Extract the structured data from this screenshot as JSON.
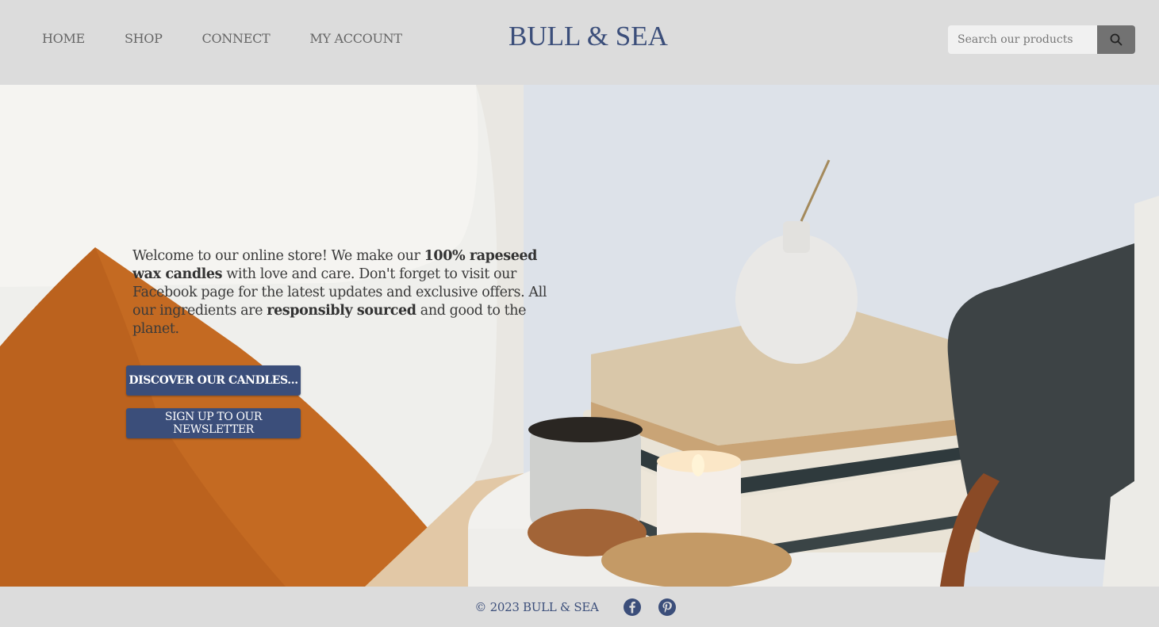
{
  "nav": {
    "items": [
      {
        "label": "HOME"
      },
      {
        "label": "SHOP"
      },
      {
        "label": "CONNECT"
      },
      {
        "label": "MY ACCOUNT"
      }
    ]
  },
  "brand": {
    "logo": "BULL & SEA",
    "color": "#3b4e7a"
  },
  "search": {
    "placeholder": "Search our products",
    "icon": "search-icon"
  },
  "hero": {
    "intro_1": "Welcome to our online store! We make our ",
    "intro_bold_1": "100% rapeseed wax candles",
    "intro_2": " with love and care. Don't forget to visit our Facebook page for the latest updates and exclusive offers. All our ingredients are ",
    "intro_bold_2": "responsibly sourced",
    "intro_3": " and good to the planet.",
    "discover_button": "DISCOVER OUR CANDLES...",
    "newsletter_button": "SIGN UP TO OUR NEWSLETTER"
  },
  "footer": {
    "copyright": "© 2023 BULL & SEA",
    "social": [
      {
        "icon": "facebook-icon"
      },
      {
        "icon": "pinterest-icon"
      }
    ]
  }
}
